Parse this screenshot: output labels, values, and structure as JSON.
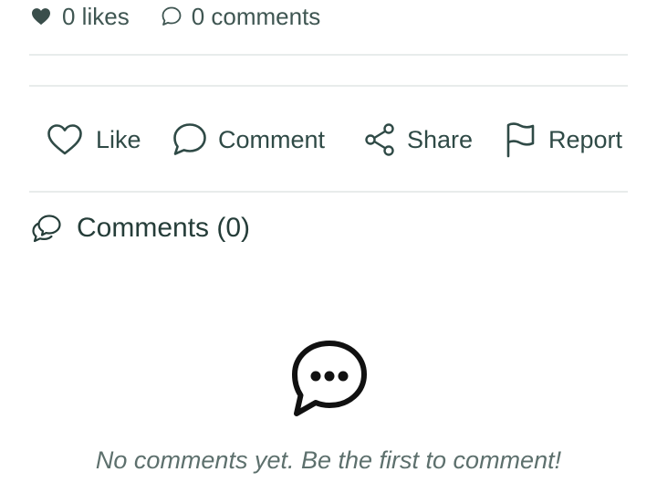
{
  "stats": {
    "likes": "0 likes",
    "comments": "0 comments",
    "likes_icon": "heart-filled-icon",
    "comments_icon": "chat-bubble-icon"
  },
  "actions": [
    {
      "label": "Like",
      "icon": "heart-outline-icon"
    },
    {
      "label": "Comment",
      "icon": "chat-bubble-icon"
    },
    {
      "label": "Share",
      "icon": "share-icon"
    },
    {
      "label": "Report",
      "icon": "flag-icon"
    }
  ],
  "comments_section": {
    "title": "Comments (0)",
    "icon": "comments-icon",
    "empty_icon": "chat-dots-icon",
    "empty_message": "No comments yet. Be the first to comment!"
  },
  "colors": {
    "text": "#2f4a46",
    "muted": "#5d706d",
    "divider": "#e8eceb"
  }
}
